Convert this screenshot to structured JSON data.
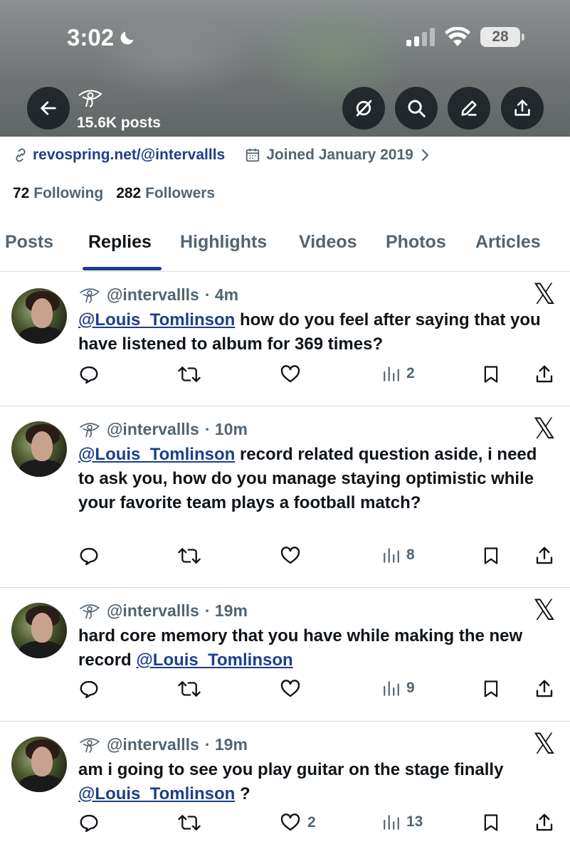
{
  "status_bar": {
    "time": "3:02",
    "battery": "28"
  },
  "header": {
    "post_count": "15.6K posts"
  },
  "profile": {
    "website": "revospring.net/@intervallls",
    "joined": "Joined January 2019",
    "following_count": "72",
    "following_label": "Following",
    "followers_count": "282",
    "followers_label": "Followers"
  },
  "tabs": [
    {
      "label": "Posts"
    },
    {
      "label": "Replies"
    },
    {
      "label": "Highlights"
    },
    {
      "label": "Videos"
    },
    {
      "label": "Photos"
    },
    {
      "label": "Articles"
    }
  ],
  "posts": [
    {
      "handle": "@intervallls",
      "time": "· 4m",
      "mention": "@Louis_Tomlinson",
      "text": " how do you feel after saying that you have listened to album for 369 times?",
      "likes": "",
      "views": "2"
    },
    {
      "handle": "@intervallls",
      "time": "· 10m",
      "mention": "@Louis_Tomlinson",
      "text": " record related question aside, i need to ask you, how do you manage staying optimistic while your favorite team plays a football match?",
      "likes": "",
      "views": "8"
    },
    {
      "handle": "@intervallls",
      "time": "· 19m",
      "text_before": "hard core memory that you have while making the new record ",
      "mention": "@Louis_Tomlinson",
      "likes": "",
      "views": "9"
    },
    {
      "handle": "@intervallls",
      "time": "· 19m",
      "text_before": "am i going to see you play guitar on the stage finally ",
      "mention": "@Louis_Tomlinson",
      "text_after": " ?",
      "likes": "2",
      "views": "13"
    }
  ],
  "colors": {
    "link": "#1d3f8a",
    "muted": "#536471",
    "text": "#0f1419"
  }
}
